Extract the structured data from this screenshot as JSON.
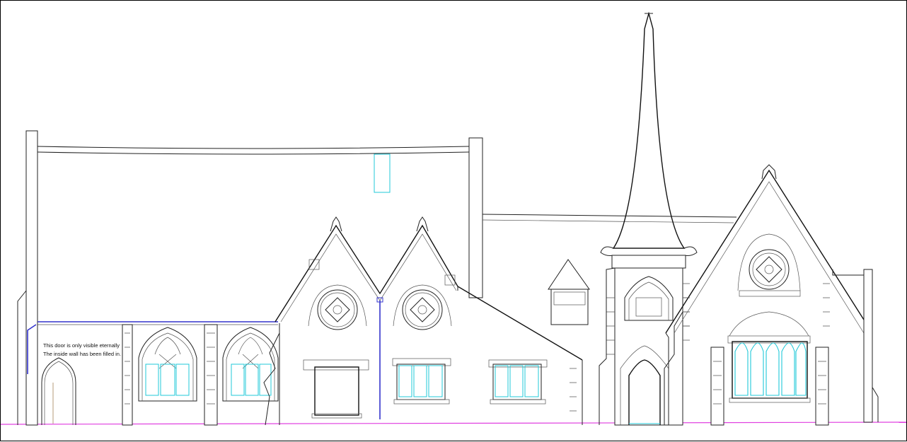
{
  "annotation": {
    "line1": "This door is only visible eternally",
    "line2": "The inside wall has been filled in."
  },
  "colors": {
    "outline": "#222222",
    "glazing": "#20c8d8",
    "downpipe": "#3333cc",
    "ground_line": "#e040e0",
    "door_panel": "#b59b7a"
  },
  "icons": {
    "rose-window-icon": "quatrefoil",
    "spire-icon": "spire"
  }
}
